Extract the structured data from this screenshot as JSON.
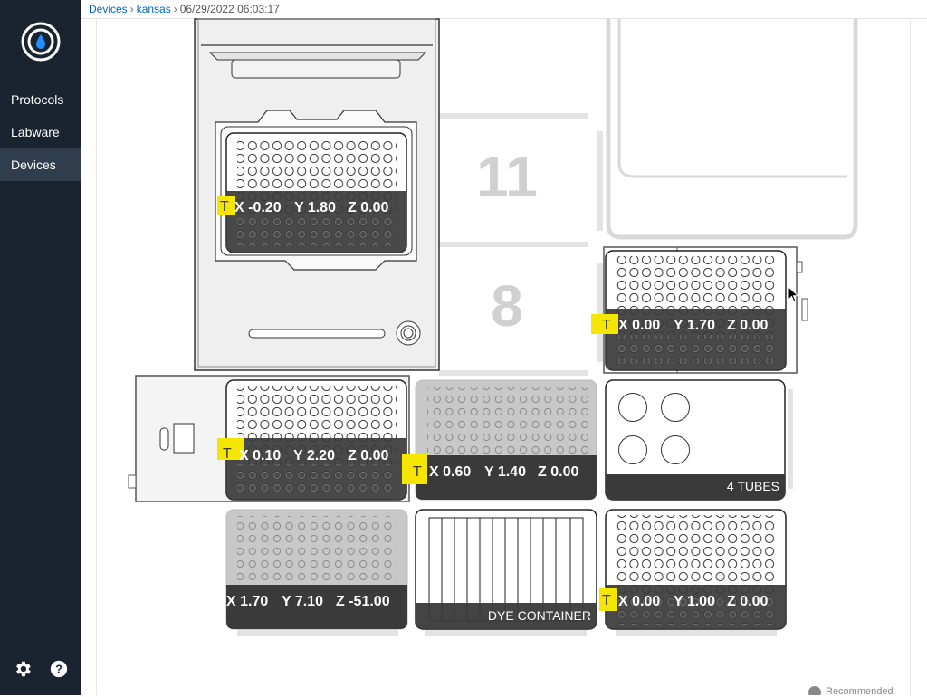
{
  "nav": {
    "items": [
      {
        "label": "Protocols"
      },
      {
        "label": "Labware"
      },
      {
        "label": "Devices"
      }
    ],
    "active": "Devices",
    "bottom_icons": [
      "gear-icon",
      "help-icon"
    ]
  },
  "breadcrumb": {
    "items": [
      "Devices",
      "kansas"
    ],
    "timestamp": "06/29/2022 06:03:17"
  },
  "deck": {
    "slot_numbers": {
      "slot_11": "11",
      "slot_8": "8"
    },
    "tip_marker": "T",
    "offsets": {
      "slot_7_plate": {
        "x": "X -0.20",
        "y": "Y 1.80",
        "z": "Z 0.00"
      },
      "slot_9_plate": {
        "x": "X 0.00",
        "y": "Y 1.70",
        "z": "Z 0.00"
      },
      "slot_4_plate": {
        "x": "X 0.10",
        "y": "Y 2.20",
        "z": "Z 0.00"
      },
      "slot_5_plate": {
        "x": "X 0.60",
        "y": "Y 1.40",
        "z": "Z 0.00"
      },
      "slot_1_plate": {
        "x": "X 1.70",
        "y": "Y 7.10",
        "z": "Z -51.00"
      },
      "slot_3_plate": {
        "x": "X 0.00",
        "y": "Y 1.00",
        "z": "Z 0.00"
      }
    },
    "labels": {
      "tubes": "4 TUBES",
      "dye": "DYE CONTAINER"
    }
  },
  "footer": {
    "recommended": "Recommended"
  },
  "colors": {
    "sidebar": "#1a2430",
    "active_nav": "#2f3d4d",
    "highlight": "#f5e600",
    "overlay": "#3a3a3a"
  }
}
